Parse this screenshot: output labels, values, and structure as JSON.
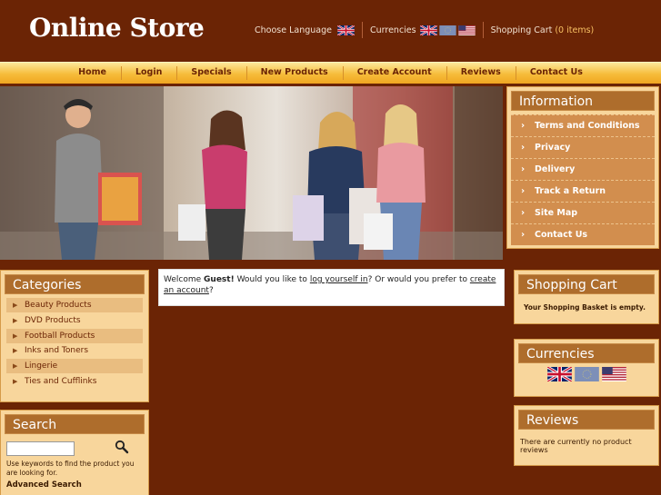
{
  "header": {
    "logo": "Online Store",
    "choose_language": "Choose Language",
    "currencies": "Currencies",
    "cart_label": "Shopping Cart",
    "cart_count": "(0 items)"
  },
  "nav": {
    "items": [
      "Home",
      "Login",
      "Specials",
      "New Products",
      "Create Account",
      "Reviews",
      "Contact Us"
    ]
  },
  "information": {
    "title": "Information",
    "items": [
      "Terms and Conditions",
      "Privacy",
      "Delivery",
      "Track a Return",
      "Site Map",
      "Contact Us"
    ]
  },
  "categories": {
    "title": "Categories",
    "items": [
      "Beauty Products",
      "DVD Products",
      "Football Products",
      "Inks and Toners",
      "Lingerie",
      "Ties and Cufflinks"
    ]
  },
  "search": {
    "title": "Search",
    "help": "Use keywords to find the product you are looking for.",
    "advanced": "Advanced Search"
  },
  "welcome": {
    "prefix": "Welcome ",
    "guest": "Guest!",
    "mid": " Would you like to ",
    "login_link": "log yourself in",
    "mid2": "? Or would you prefer to ",
    "create_link": "create an account",
    "suffix": "?"
  },
  "shopping_cart": {
    "title": "Shopping Cart",
    "empty": "Your Shopping Basket is empty."
  },
  "currency_box": {
    "title": "Currencies"
  },
  "reviews": {
    "title": "Reviews",
    "text": "There are currently no product reviews"
  },
  "colors": {
    "background": "#6b2405",
    "nav": "#f6bc3a",
    "box": "#f8d69c",
    "box_title": "#ae6d2c"
  }
}
